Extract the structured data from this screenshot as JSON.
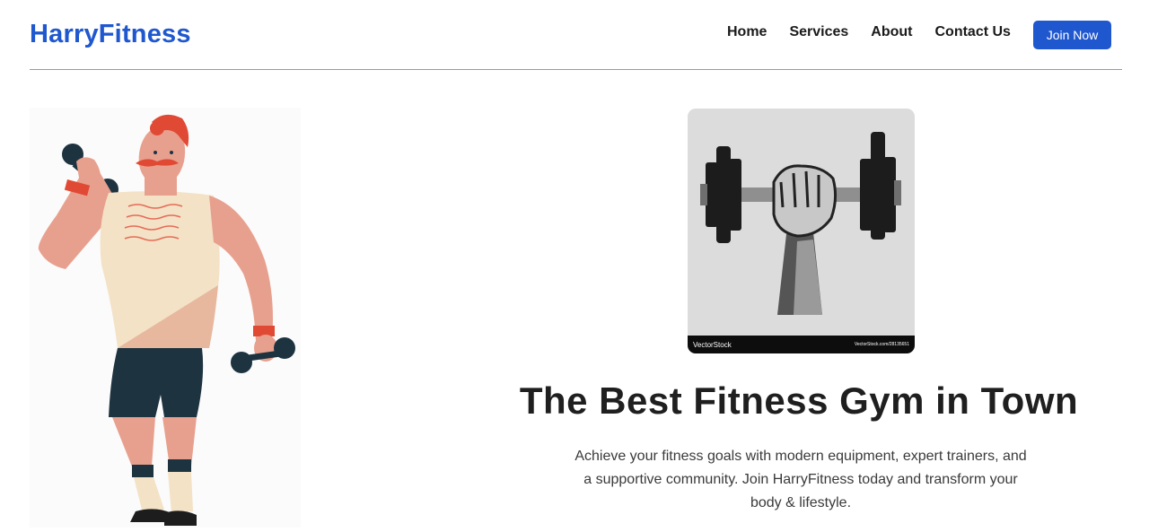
{
  "header": {
    "brand": "HarryFitness",
    "nav": [
      {
        "label": "Home"
      },
      {
        "label": "Services"
      },
      {
        "label": "About"
      },
      {
        "label": "Contact Us"
      }
    ],
    "cta_label": "Join Now"
  },
  "hero": {
    "image_watermark": "VectorStock",
    "image_id": "VectorStock.com/28135651",
    "title": "The Best Fitness Gym in Town",
    "description": "Achieve your fitness goals with modern equipment, expert trainers, and a supportive community. Join HarryFitness today and transform your body & lifestyle."
  },
  "colors": {
    "brand": "#1f57cf",
    "text": "#1a1a1a",
    "card_bg": "#dcdcdc"
  },
  "icons": {
    "illustration": "bodybuilder-illustration",
    "card": "dumbbell-fist-icon"
  }
}
